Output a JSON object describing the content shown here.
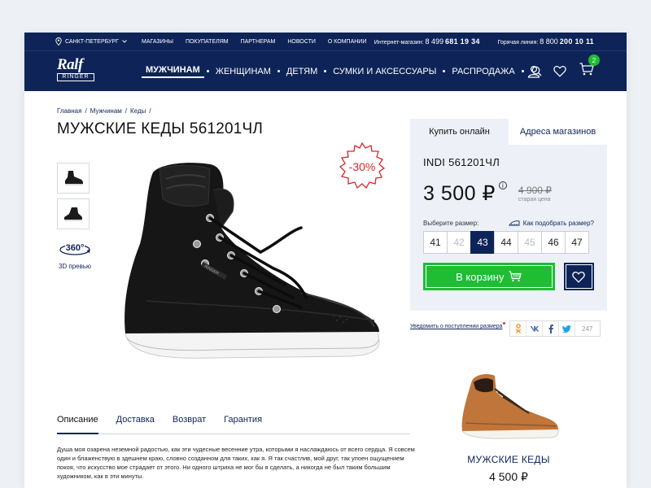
{
  "topbar": {
    "city": "САНКТ-ПЕТЕРБУРГ",
    "links": [
      "МАГАЗИНЫ",
      "ПОКУПАТЕЛЯМ",
      "ПАРТНЕРАМ",
      "НОВОСТИ",
      "О КОМПАНИИ"
    ],
    "online_label": "Интернет-магазин:",
    "online_phone_prefix": "8 499",
    "online_phone": "681 19 34",
    "hotline_label": "Горячая линия:",
    "hotline_phone_prefix": "8 800",
    "hotline_phone": "200 10 11"
  },
  "logo": {
    "brand": "Ralf",
    "sub": "RINGER"
  },
  "nav": {
    "items": [
      "МУЖЧИНАМ",
      "ЖЕНЩИНАМ",
      "ДЕТЯМ",
      "СУМКИ И АКСЕССУАРЫ",
      "РАСПРОДАЖА"
    ],
    "active_index": 0,
    "cart_count": "2"
  },
  "breadcrumb": [
    "Главная",
    "Мужчинам",
    "Кеды"
  ],
  "product": {
    "title": "МУЖСКИЕ КЕДЫ 561201ЧЛ",
    "discount": "-30%",
    "view360_badge": "360°",
    "view360_label": "3D превью"
  },
  "purchase": {
    "tabs": [
      "Купить онлайн",
      "Адреса магазинов"
    ],
    "model": "INDI 561201ЧЛ",
    "price": "3 500 ₽",
    "old_price": "4 900 ₽",
    "old_price_label": "старая цена",
    "size_label": "Выберите размер:",
    "size_guide": "Как подобрать размер?",
    "sizes": [
      "41",
      "42",
      "43",
      "44",
      "45",
      "46",
      "47"
    ],
    "sizes_unavailable": [
      "42",
      "45"
    ],
    "size_selected": "43",
    "cart_button": "В корзину"
  },
  "notify": "Уведомить о поступлении размера",
  "share": {
    "count": "247"
  },
  "details_tabs": [
    "Описание",
    "Доставка",
    "Возврат",
    "Гарантия"
  ],
  "description": "Душа моя озарена неземной радостью, как эти чудесные весенние утра, которыми я наслаждаюсь от всего сердца. Я совсем один и блаженствую в здешнем краю, словно созданном для таких, как я. Я так счастлив, мой друг, так упоен ощущением покоя, что искусство мое страдает от этого. Ни одного штриха не мог бы я сделать, а никогда не был таким большим художником, как в эти минуты.",
  "recommended": {
    "title": "МУЖСКИЕ КЕДЫ",
    "price": "4 500 ₽"
  },
  "colors": {
    "navy": "#0e2458",
    "green": "#1ebd33",
    "discount_red": "#d8262a",
    "panel_bg": "#edf1f7"
  }
}
